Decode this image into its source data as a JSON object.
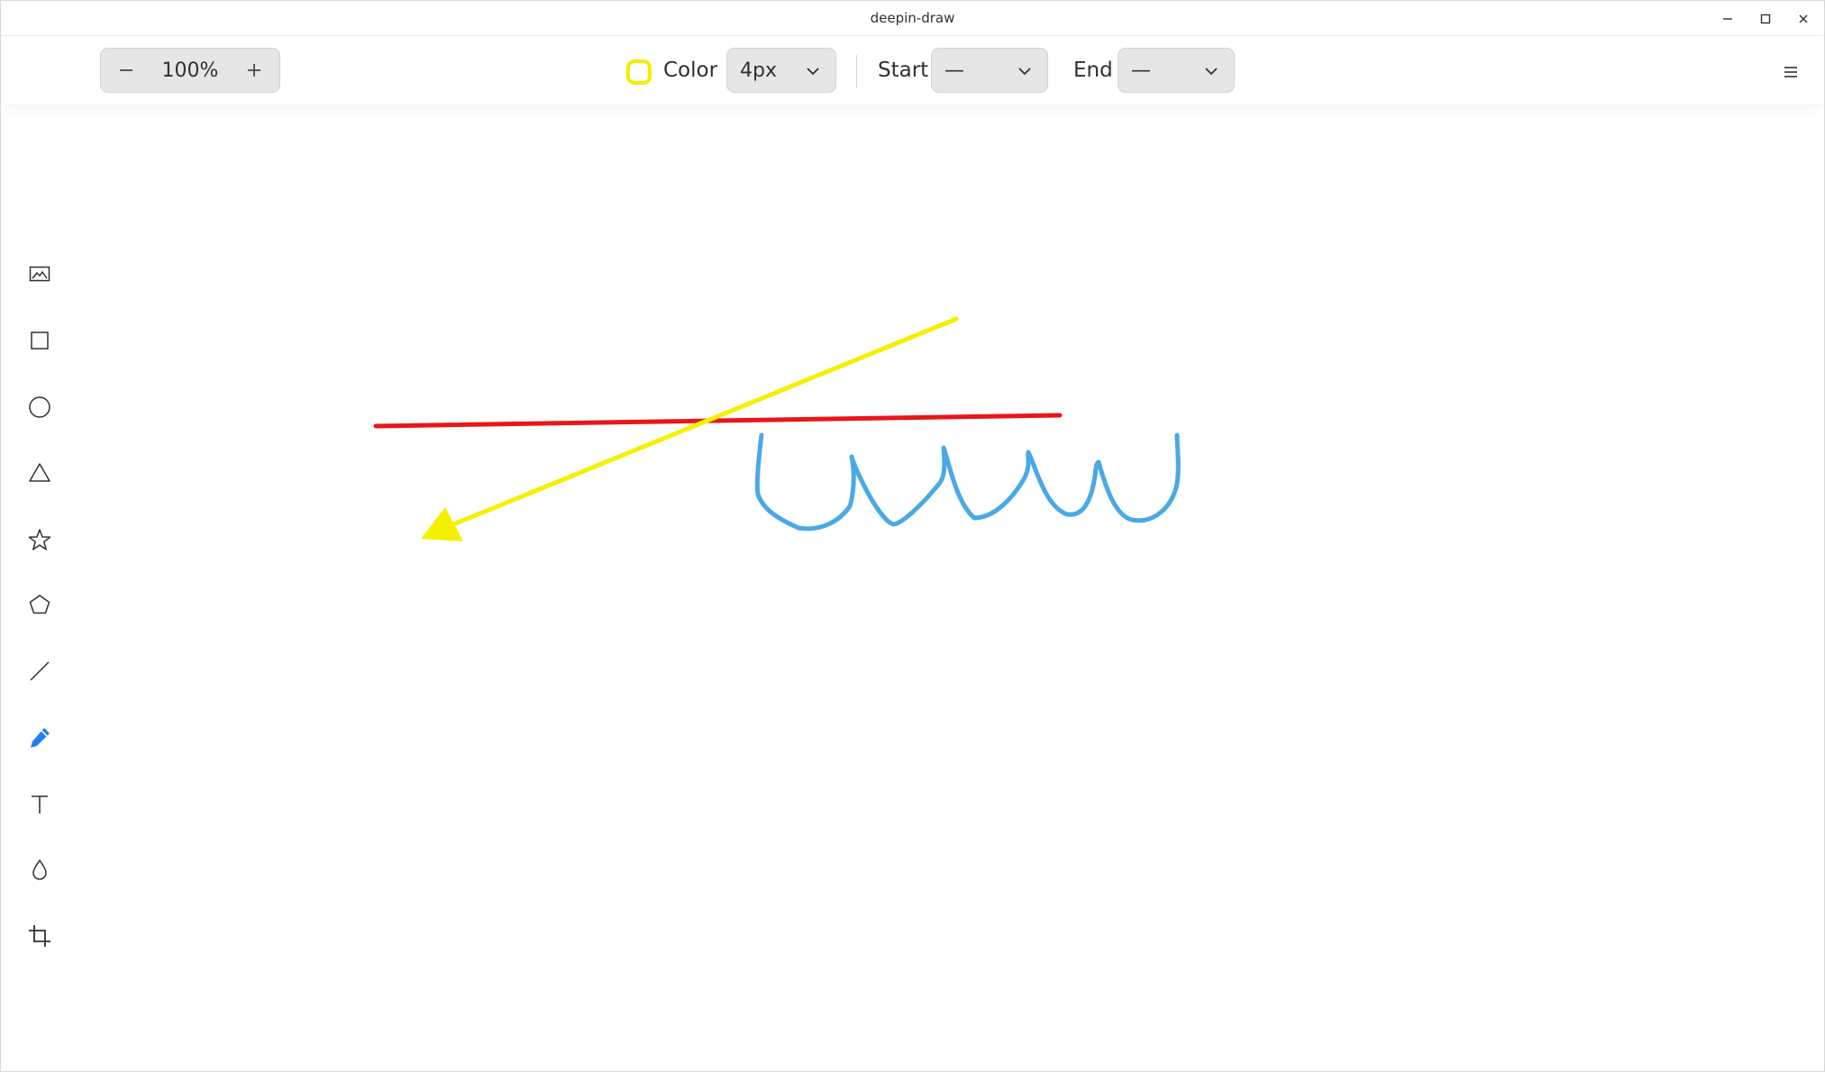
{
  "window": {
    "title": "deepin-draw"
  },
  "toolbar": {
    "zoom_value": "100%",
    "color_label": "Color",
    "color_value": "#f2ef00",
    "stroke_width": "4px",
    "start_label": "Start",
    "start_value": "—",
    "end_label": "End",
    "end_value": "—"
  },
  "tools": [
    {
      "name": "image-icon"
    },
    {
      "name": "rectangle-icon"
    },
    {
      "name": "ellipse-icon"
    },
    {
      "name": "triangle-icon"
    },
    {
      "name": "star-icon"
    },
    {
      "name": "polygon-icon"
    },
    {
      "name": "line-icon"
    },
    {
      "name": "pencil-icon",
      "active": true
    },
    {
      "name": "text-icon"
    },
    {
      "name": "blur-icon"
    },
    {
      "name": "crop-icon"
    }
  ],
  "colors": {
    "accent": "#1f7ff0",
    "red_line": "#e8161a",
    "yellow_arrow": "#f5f000",
    "blue_freehand": "#4aa8e6"
  }
}
